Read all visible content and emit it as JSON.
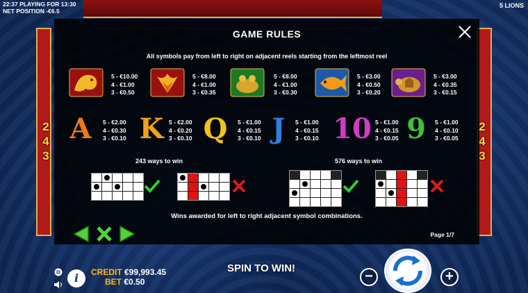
{
  "status": {
    "time": "22:37",
    "playing_label": "PLAYING FOR 13:30",
    "net_position": "NET POSITION -€6.5",
    "game_name": "5 LIONS"
  },
  "side_ways": [
    "2",
    "4",
    "3"
  ],
  "rules": {
    "title": "GAME RULES",
    "subtitle": "All symbols pay from left to right on adjacent reels starting from the leftmost reel",
    "symbols_row1": [
      {
        "icon": "dragon-icon",
        "pays": [
          "5 - €10.00",
          "4 - €1.00",
          "3 - €0.50"
        ]
      },
      {
        "icon": "phoenix-icon",
        "pays": [
          "5 - €8.00",
          "4 - €1.00",
          "3 - €0.35"
        ]
      },
      {
        "icon": "golden-frog-icon",
        "pays": [
          "5 - €8.00",
          "4 - €1.00",
          "3 - €0.30"
        ]
      },
      {
        "icon": "koi-fish-icon",
        "pays": [
          "5 - €3.00",
          "4 - €0.50",
          "3 - €0.20"
        ]
      },
      {
        "icon": "turtle-icon",
        "pays": [
          "5 - €3.00",
          "4 - €0.35",
          "3 - €0.15"
        ]
      }
    ],
    "symbols_row2": [
      {
        "letter": "A",
        "color": "#f07a12",
        "pays": [
          "5 - €2.00",
          "4 - €0.30",
          "3 - €0.10"
        ]
      },
      {
        "letter": "K",
        "color": "#f0a21c",
        "pays": [
          "5 - €2.00",
          "4 - €0.20",
          "3 - €0.10"
        ]
      },
      {
        "letter": "Q",
        "color": "#f2c21a",
        "pays": [
          "5 - €1.00",
          "4 - €0.15",
          "3 - €0.10"
        ]
      },
      {
        "letter": "J",
        "color": "#2f7fe0",
        "pays": [
          "5 - €1.00",
          "4 - €0.15",
          "3 - €0.10"
        ]
      },
      {
        "letter": "10",
        "color": "#d23cc4",
        "pays": [
          "5 - €1.00",
          "4 - €0.15",
          "3 - €0.05"
        ]
      },
      {
        "letter": "9",
        "color": "#3fbf3a",
        "pays": [
          "5 - €1.00",
          "4 - €0.10",
          "3 - €0.05"
        ]
      }
    ],
    "ways_243_label": "243 ways to win",
    "ways_576_label": "576 ways to win",
    "footer": "Wins awarded for left to right adjacent symbol combinations.",
    "page": "Page 1/7"
  },
  "hud": {
    "credit_label": "CREDIT",
    "credit_value": "€99,993.45",
    "bet_label": "BET",
    "bet_value": "€0.50",
    "spin_label": "SPIN TO WIN!",
    "info_label": "i",
    "minus_label": "−",
    "plus_label": "+"
  },
  "colors": {
    "accent": "#ffb814",
    "check": "#2fd02f",
    "cross": "#e01a1a",
    "panel": "#000000"
  }
}
